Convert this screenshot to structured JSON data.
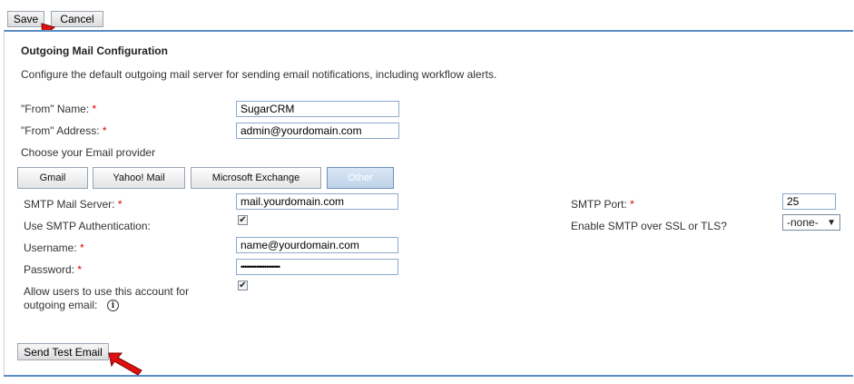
{
  "toolbar": {
    "save_label": "Save",
    "cancel_label": "Cancel"
  },
  "section": {
    "title": "Outgoing Mail Configuration",
    "description": "Configure the default outgoing mail server for sending email notifications, including workflow alerts."
  },
  "form": {
    "from_name": {
      "label": "\"From\" Name:",
      "value": "SugarCRM"
    },
    "from_address": {
      "label": "\"From\" Address:",
      "value": "admin@yourdomain.com"
    },
    "provider_prompt": "Choose your Email provider",
    "providers": [
      "Gmail",
      "Yahoo! Mail",
      "Microsoft Exchange",
      "Other"
    ],
    "selected_provider": "Other",
    "smtp_server": {
      "label": "SMTP Mail Server:",
      "value": "mail.yourdomain.com"
    },
    "smtp_auth": {
      "label": "Use SMTP Authentication:",
      "checked": true
    },
    "username": {
      "label": "Username:",
      "value": "name@yourdomain.com"
    },
    "password": {
      "label": "Password:",
      "value": "••••••••••••••••••••"
    },
    "allow_users": {
      "label_line1": "Allow users to use this account for",
      "label_line2": "outgoing email:",
      "checked": true
    },
    "smtp_port": {
      "label": "SMTP Port:",
      "value": "25"
    },
    "ssl_tls": {
      "label": "Enable SMTP over SSL or TLS?",
      "selected": "-none-"
    },
    "required_mark": "*"
  },
  "actions": {
    "send_test_label": "Send Test Email"
  },
  "icons": {
    "info": "info-icon",
    "arrow": "red-pointer-arrow-icon"
  },
  "colors": {
    "accent": "#5b8ec4",
    "required": "#dd0000",
    "arrow": "#e01010"
  }
}
